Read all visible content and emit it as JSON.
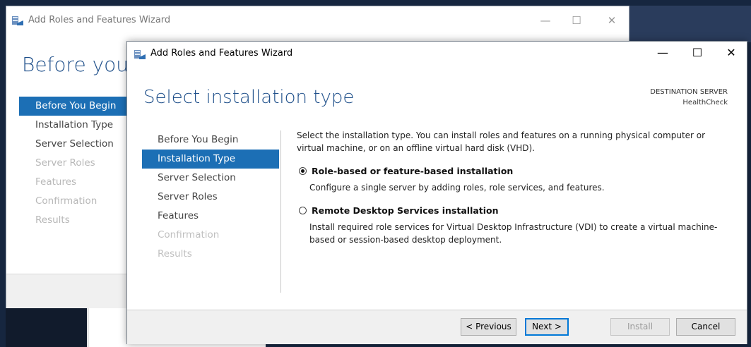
{
  "colors": {
    "accent": "#1c6fb5",
    "heading": "#1e4f8a",
    "disabled_text": "#c0c0c0"
  },
  "back_window": {
    "title": "Add Roles and Features Wizard",
    "heading": "Before you be",
    "controls": {
      "minimize": "—",
      "maximize": "☐",
      "close": "✕"
    },
    "nav": [
      {
        "label": "Before You Begin",
        "state": "active"
      },
      {
        "label": "Installation Type",
        "state": "normal"
      },
      {
        "label": "Server Selection",
        "state": "normal"
      },
      {
        "label": "Server Roles",
        "state": "disabled"
      },
      {
        "label": "Features",
        "state": "disabled"
      },
      {
        "label": "Confirmation",
        "state": "disabled"
      },
      {
        "label": "Results",
        "state": "disabled"
      }
    ]
  },
  "front_window": {
    "title": "Add Roles and Features Wizard",
    "app_icon": "server-manager-icon",
    "controls": {
      "minimize": "—",
      "maximize": "☐",
      "close": "✕"
    },
    "heading": "Select installation type",
    "destination": {
      "label": "DESTINATION SERVER",
      "server": "HealthCheck"
    },
    "nav": [
      {
        "label": "Before You Begin",
        "state": "normal"
      },
      {
        "label": "Installation Type",
        "state": "active"
      },
      {
        "label": "Server Selection",
        "state": "normal"
      },
      {
        "label": "Server Roles",
        "state": "normal"
      },
      {
        "label": "Features",
        "state": "normal"
      },
      {
        "label": "Confirmation",
        "state": "disabled"
      },
      {
        "label": "Results",
        "state": "disabled"
      }
    ],
    "intro": "Select the installation type. You can install roles and features on a running physical computer or virtual machine, or on an offline virtual hard disk (VHD).",
    "options": [
      {
        "title": "Role-based or feature-based installation",
        "description": "Configure a single server by adding roles, role services, and features.",
        "selected": true
      },
      {
        "title": "Remote Desktop Services installation",
        "description": "Install required role services for Virtual Desktop Infrastructure (VDI) to create a virtual machine-based or session-based desktop deployment.",
        "selected": false
      }
    ],
    "buttons": {
      "previous": "< Previous",
      "next": "Next >",
      "install": "Install",
      "cancel": "Cancel"
    }
  }
}
